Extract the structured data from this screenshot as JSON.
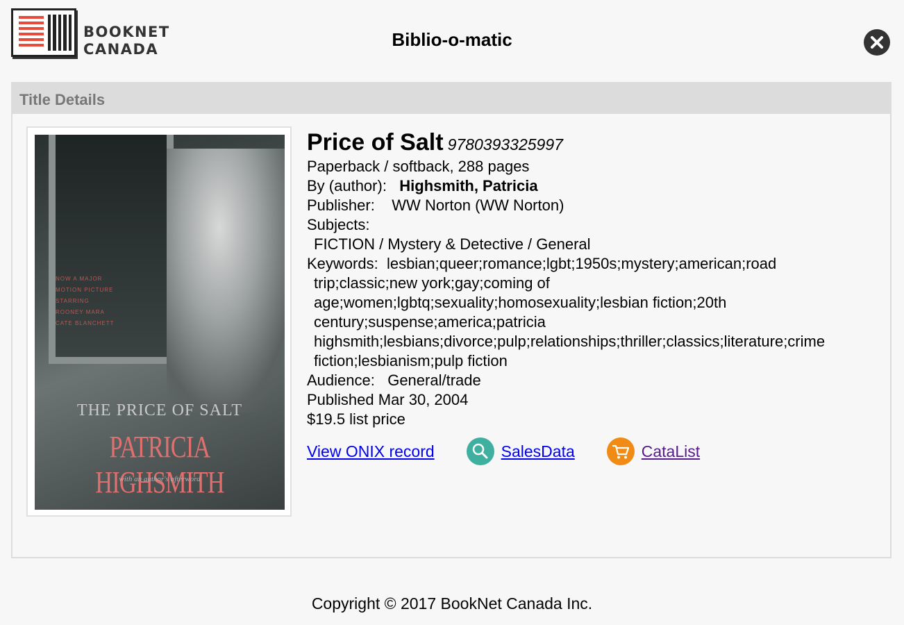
{
  "header": {
    "logo_line1": "BOOKNET",
    "logo_line2": "CANADA",
    "app_title": "Biblio-o-matic",
    "close_icon": "close-icon"
  },
  "panel": {
    "heading": "Title Details"
  },
  "cover": {
    "blurb": "NOW A MAJOR MOTION PICTURE STARRING ROONEY MARA CATE BLANCHETT",
    "title_line1": "THE PRICE OF SALT",
    "author": "PATRICIA HIGHSMITH",
    "subtitle": "with an author's afterword"
  },
  "book": {
    "title": "Price of Salt",
    "isbn": "9780393325997",
    "format": "Paperback / softback, 288 pages",
    "author_label": "By (author):",
    "author": "Highsmith, Patricia",
    "publisher_label": "Publisher:",
    "publisher": "WW Norton (WW Norton)",
    "subjects_label": "Subjects:",
    "subject": "FICTION / Mystery & Detective / General",
    "keywords_label": "Keywords:",
    "keywords": "lesbian;queer;romance;lgbt;1950s;mystery;american;road trip;classic;new york;gay;coming of age;women;lgbtq;sexuality;homosexuality;lesbian fiction;20th century;suspense;america;patricia highsmith;lesbians;divorce;pulp;relationships;thriller;classics;literature;crime fiction;lesbianism;pulp fiction",
    "audience_label": "Audience:",
    "audience": "General/trade",
    "published": "Published Mar 30, 2004",
    "price": "$19.5 list price"
  },
  "links": {
    "onix": "View ONIX record",
    "salesdata": "SalesData",
    "salesdata_icon": "magnifier-icon",
    "catalist": "CataList",
    "catalist_icon": "cart-icon",
    "teal": "#3fb0a0",
    "orange": "#f08c15"
  },
  "footer": {
    "copyright": "Copyright © 2017 BookNet Canada Inc."
  }
}
